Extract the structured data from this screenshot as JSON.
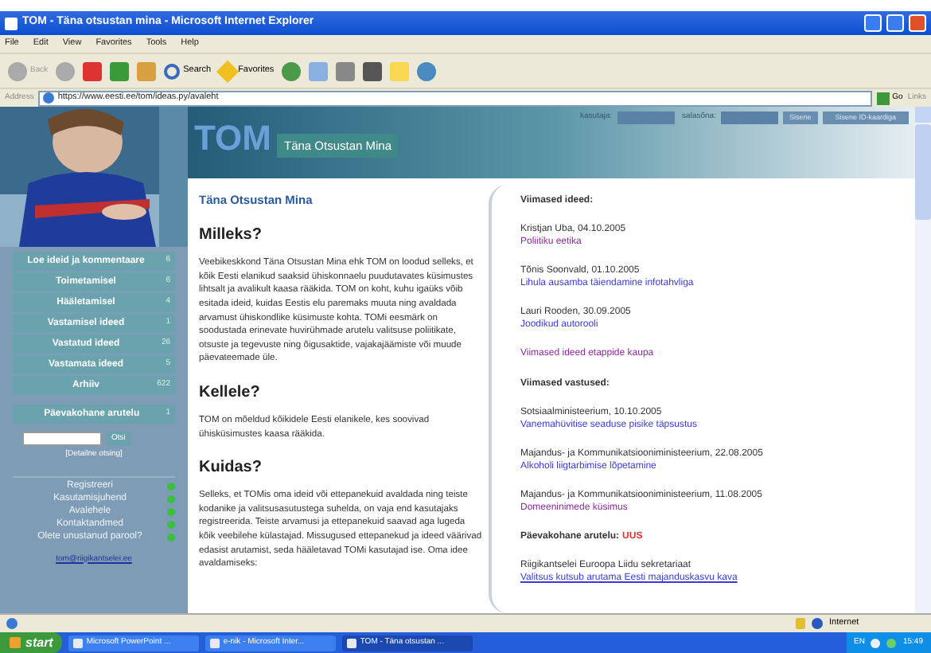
{
  "window": {
    "title": "TOM - Täna otsustan mina - Microsoft Internet Explorer"
  },
  "menu": [
    "File",
    "Edit",
    "View",
    "Favorites",
    "Tools",
    "Help"
  ],
  "toolbar": {
    "back": "Back",
    "search": "Search",
    "favorites": "Favorites"
  },
  "address": {
    "label": "Address",
    "url": "https://www.eesti.ee/tom/ideas.py/avaleht",
    "go": "Go",
    "links": "Links"
  },
  "header": {
    "logo": "TOM",
    "tagline": "Täna Otsustan Mina",
    "user_label": "kasutaja:",
    "password_label": "salasõna:",
    "login": "Sisene",
    "id_login": "Sisene ID-kaardiga"
  },
  "sidebar": {
    "items": [
      {
        "label": "Loe ideid ja kommentaare",
        "count": "6"
      },
      {
        "label": "Toimetamisel",
        "count": "6"
      },
      {
        "label": "Hääletamisel",
        "count": "4"
      },
      {
        "label": "Vastamisel ideed",
        "count": "1"
      },
      {
        "label": "Vastatud ideed",
        "count": "26"
      },
      {
        "label": "Vastamata ideed",
        "count": "5"
      },
      {
        "label": "Arhiiv",
        "count": "622"
      }
    ],
    "topical": {
      "label": "Päevakohane arutelu",
      "count": "1"
    },
    "search_button": "Otsi",
    "detailed_search": "[Detailne otsing]",
    "links": [
      "Registreeri",
      "Kasutamisjuhend",
      "Avalehele",
      "Kontaktandmed",
      "Olete unustanud parool?"
    ],
    "email": "tom@riigikantselei.ee"
  },
  "content": {
    "title": "Täna Otsustan Mina",
    "sections": [
      {
        "heading": "Milleks?",
        "text": "Veebikeskkond Täna Otsustan Mina ehk TOM on loodud selleks, et kõik Eesti elanikud saaksid ühiskonnaelu puudutavates küsimustes lihtsalt ja avalikult kaasa rääkida. TOM on koht, kuhu igaüks võib esitada ideid, kuidas Eestis elu paremaks muuta ning avaldada arvamust ühiskondlike küsimuste kohta. TOMi eesmärk on soodustada erinevate huvirühmade arutelu valitsuse poliitikate, otsuste ja tegevuste ning õigusaktide, vajakajäämiste või muude päevateemade üle."
      },
      {
        "heading": "Kellele?",
        "text": "TOM on mõeldud kõikidele Eesti elanikele, kes soovivad ühisküsimustes kaasa rääkida."
      },
      {
        "heading": "Kuidas?",
        "text": "Selleks, et TOMis oma ideid või ettepanekuid avaldada ning teiste kodanike ja valitsusasutustega suhelda, on vaja end kasutajaks registreerida. Teiste arvamusi ja ettepanekuid saavad aga lugeda kõik veebilehe külastajad. Missugused ettepanekud ja ideed väärivad edasist arutamist, seda hääletavad TOMi kasutajad ise. Oma idee avaldamiseks:"
      }
    ]
  },
  "latest_ideas": {
    "heading": "Viimased ideed:",
    "items": [
      {
        "author": "Kristjan Uba, 04.10.2005",
        "link": "Poliitiku eetika",
        "visited": true
      },
      {
        "author": "Tõnis Soonvald, 01.10.2005",
        "link": "Lihula ausamba täiendamine infotahvliga",
        "visited": false
      },
      {
        "author": "Lauri Rooden, 30.09.2005",
        "link": "Joodikud autorooli",
        "visited": false
      }
    ],
    "more": "Viimased ideed etappide kaupa"
  },
  "latest_answers": {
    "heading": "Viimased vastused:",
    "items": [
      {
        "author": "Sotsiaalministeerium, 10.10.2005",
        "link": "Vanemahüvitise seaduse pisike täpsustus",
        "visited": false
      },
      {
        "author": "Majandus- ja Kommunikatsiooniministeerium, 22.08.2005",
        "link": "Alkoholi liigtarbimise lõpetamine",
        "visited": false
      },
      {
        "author": "Majandus- ja Kommunikatsiooniministeerium, 11.08.2005",
        "link": "Domeeninimede küsimus",
        "visited": true
      }
    ]
  },
  "topical": {
    "heading": "Päevakohane arutelu:",
    "badge": "UUS",
    "author": "Riigikantselei Euroopa Liidu sekretariaat",
    "link": "Valitsus kutsub arutama Eesti majanduskasvu kava",
    "visited": false
  },
  "status_bar": {
    "zone": "Internet"
  },
  "taskbar": {
    "start": "start",
    "tasks": [
      {
        "label": "Microsoft PowerPoint ...",
        "selected": false
      },
      {
        "label": "e-nik - Microsoft Inter...",
        "selected": false
      },
      {
        "label": "TOM - Täna otsustan ...",
        "selected": true
      }
    ],
    "language": "EN",
    "clock": "15:49"
  }
}
